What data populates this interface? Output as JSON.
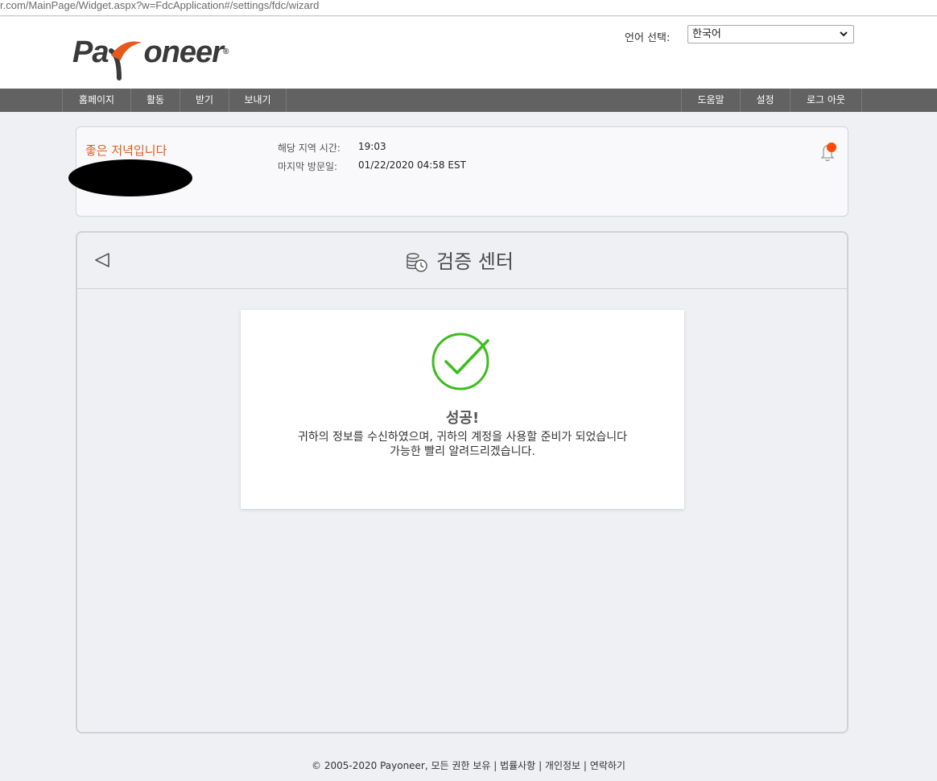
{
  "browser": {
    "url": "r.com/MainPage/Widget.aspx?w=FdcApplication#/settings/fdc/wizard"
  },
  "header": {
    "logo_left": "Pa",
    "logo_right": "oneer",
    "logo_reg": "®",
    "language_label": "언어 선택:",
    "language_selected": "한국어",
    "icons": {
      "dropdown": "chevron-down-icon"
    }
  },
  "nav": {
    "left": [
      "홈페이지",
      "활동",
      "받기",
      "보내기"
    ],
    "right": [
      "도움말",
      "설정",
      "로그 아웃"
    ]
  },
  "greeting_card": {
    "greeting": "좋은 저녁입니다",
    "local_time_label": "해당 지역 시간:",
    "local_time_value": "19:03",
    "last_visit_label": "마지막 방문일:",
    "last_visit_value": "01/22/2020 04:58 EST",
    "icons": {
      "notification": "bell-icon"
    },
    "accent_color": "#e55a1c",
    "notification_dot_color": "#ff4a00"
  },
  "verification": {
    "title": "검증 센터",
    "icons": {
      "back": "back-arrow-icon",
      "title": "coins-clock-icon",
      "status": "success-check-icon"
    },
    "success_title": "성공!",
    "success_line1": "귀하의 정보를 수신하였으며, 귀하의 계정을 사용할 준비가 되었습니다",
    "success_line2": "가능한 빨리 알려드리겠습니다.",
    "success_color": "#3cbd1c"
  },
  "footer": {
    "copyright": "© 2005-2020 Payoneer, 모든 권한 보유",
    "links": [
      "법률사항",
      "개인정보",
      "연락하기"
    ]
  }
}
